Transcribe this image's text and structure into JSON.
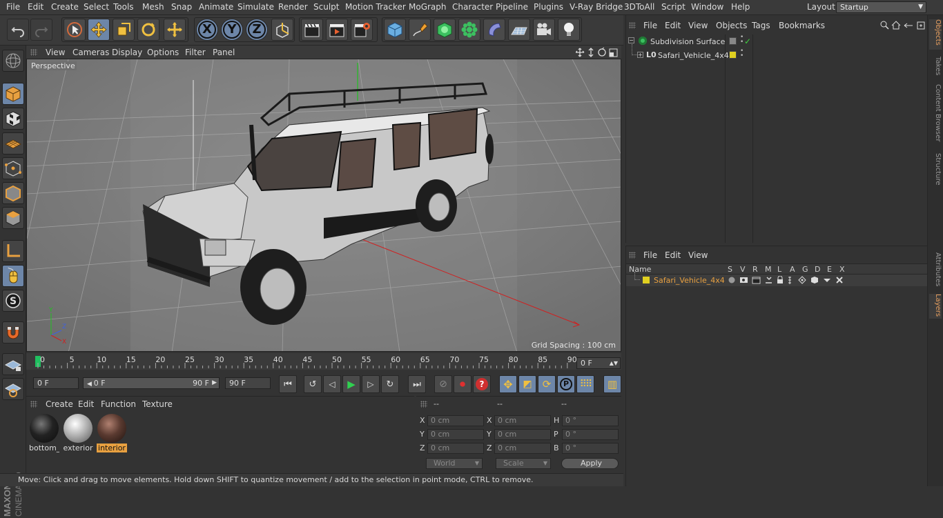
{
  "menubar": {
    "items": [
      "File",
      "Edit",
      "Create",
      "Select",
      "Tools",
      "Mesh",
      "Snap",
      "Animate",
      "Simulate",
      "Render",
      "Sculpt",
      "Motion Tracker",
      "MoGraph",
      "Character",
      "Pipeline",
      "Plugins",
      "V-Ray Bridge",
      "3DToAll",
      "Script",
      "Window",
      "Help"
    ],
    "layout_label": "Layout:",
    "layout_value": "Startup"
  },
  "toolbar": {
    "axis_x": "X",
    "axis_y": "Y",
    "axis_z": "Z"
  },
  "viewport": {
    "menu": [
      "View",
      "Cameras",
      "Display",
      "Options",
      "Filter",
      "Panel"
    ],
    "camera_label": "Perspective",
    "grid_spacing": "Grid Spacing : 100 cm"
  },
  "timeline": {
    "ticks": [
      "0",
      "5",
      "10",
      "15",
      "20",
      "25",
      "30",
      "35",
      "40",
      "45",
      "50",
      "55",
      "60",
      "65",
      "70",
      "75",
      "80",
      "85",
      "90"
    ],
    "current_frame": "0 F"
  },
  "transport": {
    "start_field": "0 F",
    "range_start": "0 F",
    "range_end": "90 F",
    "end_field": "90 F"
  },
  "materials": {
    "menu": [
      "Create",
      "Edit",
      "Function",
      "Texture"
    ],
    "items": [
      {
        "label": "bottom_",
        "selected": false
      },
      {
        "label": "exterior",
        "selected": false
      },
      {
        "label": "interior",
        "selected": true
      }
    ]
  },
  "coordinates": {
    "header": [
      "--",
      "--",
      "--"
    ],
    "rows": [
      {
        "l1": "X",
        "v1": "0 cm",
        "l2": "X",
        "v2": "0 cm",
        "l3": "H",
        "v3": "0 °"
      },
      {
        "l1": "Y",
        "v1": "0 cm",
        "l2": "Y",
        "v2": "0 cm",
        "l3": "P",
        "v3": "0 °"
      },
      {
        "l1": "Z",
        "v1": "0 cm",
        "l2": "Z",
        "v2": "0 cm",
        "l3": "B",
        "v3": "0 °"
      }
    ],
    "world": "World",
    "scale": "Scale",
    "apply": "Apply"
  },
  "status": "Move: Click and drag to move elements. Hold down SHIFT to quantize movement / add to the selection in point mode, CTRL to remove.",
  "objects": {
    "menu": [
      "File",
      "Edit",
      "View",
      "Objects",
      "Tags",
      "Bookmarks"
    ],
    "tree": [
      {
        "name": "Subdivision Surface"
      },
      {
        "name": "Safari_Vehicle_4x4"
      }
    ]
  },
  "layers": {
    "menu": [
      "File",
      "Edit",
      "View"
    ],
    "columns": {
      "name": "Name",
      "flags": [
        "S",
        "V",
        "R",
        "M",
        "L",
        "A",
        "G",
        "D",
        "E",
        "X"
      ]
    },
    "rows": [
      {
        "name": "Safari_Vehicle_4x4",
        "color": "#e0d020"
      }
    ]
  },
  "right_tabs": [
    "Objects",
    "Takes",
    "Content Browser",
    "Structure",
    "Attributes",
    "Layers"
  ],
  "colors": {
    "accent": "#6d86a8",
    "selected_text": "#e8a040",
    "layer_color": "#e0d020"
  }
}
